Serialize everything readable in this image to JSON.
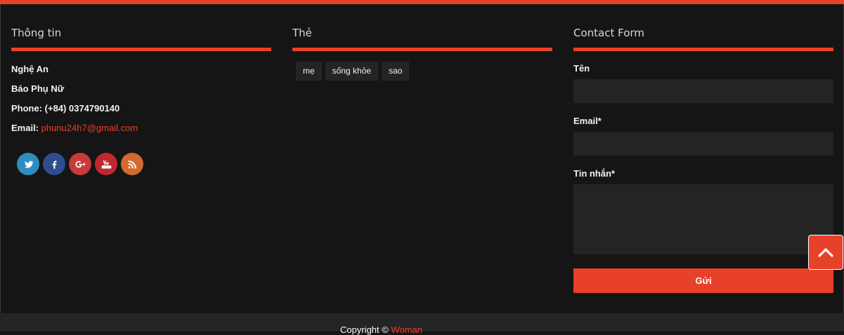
{
  "colors": {
    "accent": "#e8412a",
    "background": "#151515",
    "field": "#242424"
  },
  "info": {
    "title": "Thông tin",
    "lines": [
      "Nghệ An",
      "Báo Phụ Nữ",
      "Phone: (+84) 0374790140"
    ],
    "email_label": "Email:",
    "email_value": "phunu24h7@gmail.com",
    "social": [
      "twitter-icon",
      "facebook-icon",
      "google-plus-icon",
      "youtube-icon",
      "rss-icon"
    ]
  },
  "tags": {
    "title": "Thẻ",
    "items": [
      "mẹ",
      "sống khỏe",
      "sao"
    ]
  },
  "contact": {
    "title": "Contact Form",
    "name_label": "Tên",
    "email_label": "Email*",
    "message_label": "Tin nhắn*",
    "submit_label": "Gửi"
  },
  "scroll_top": {
    "icon": "chevron-up-icon"
  },
  "footer": {
    "copyright_prefix": "Copyright ©",
    "brand": "Woman"
  }
}
